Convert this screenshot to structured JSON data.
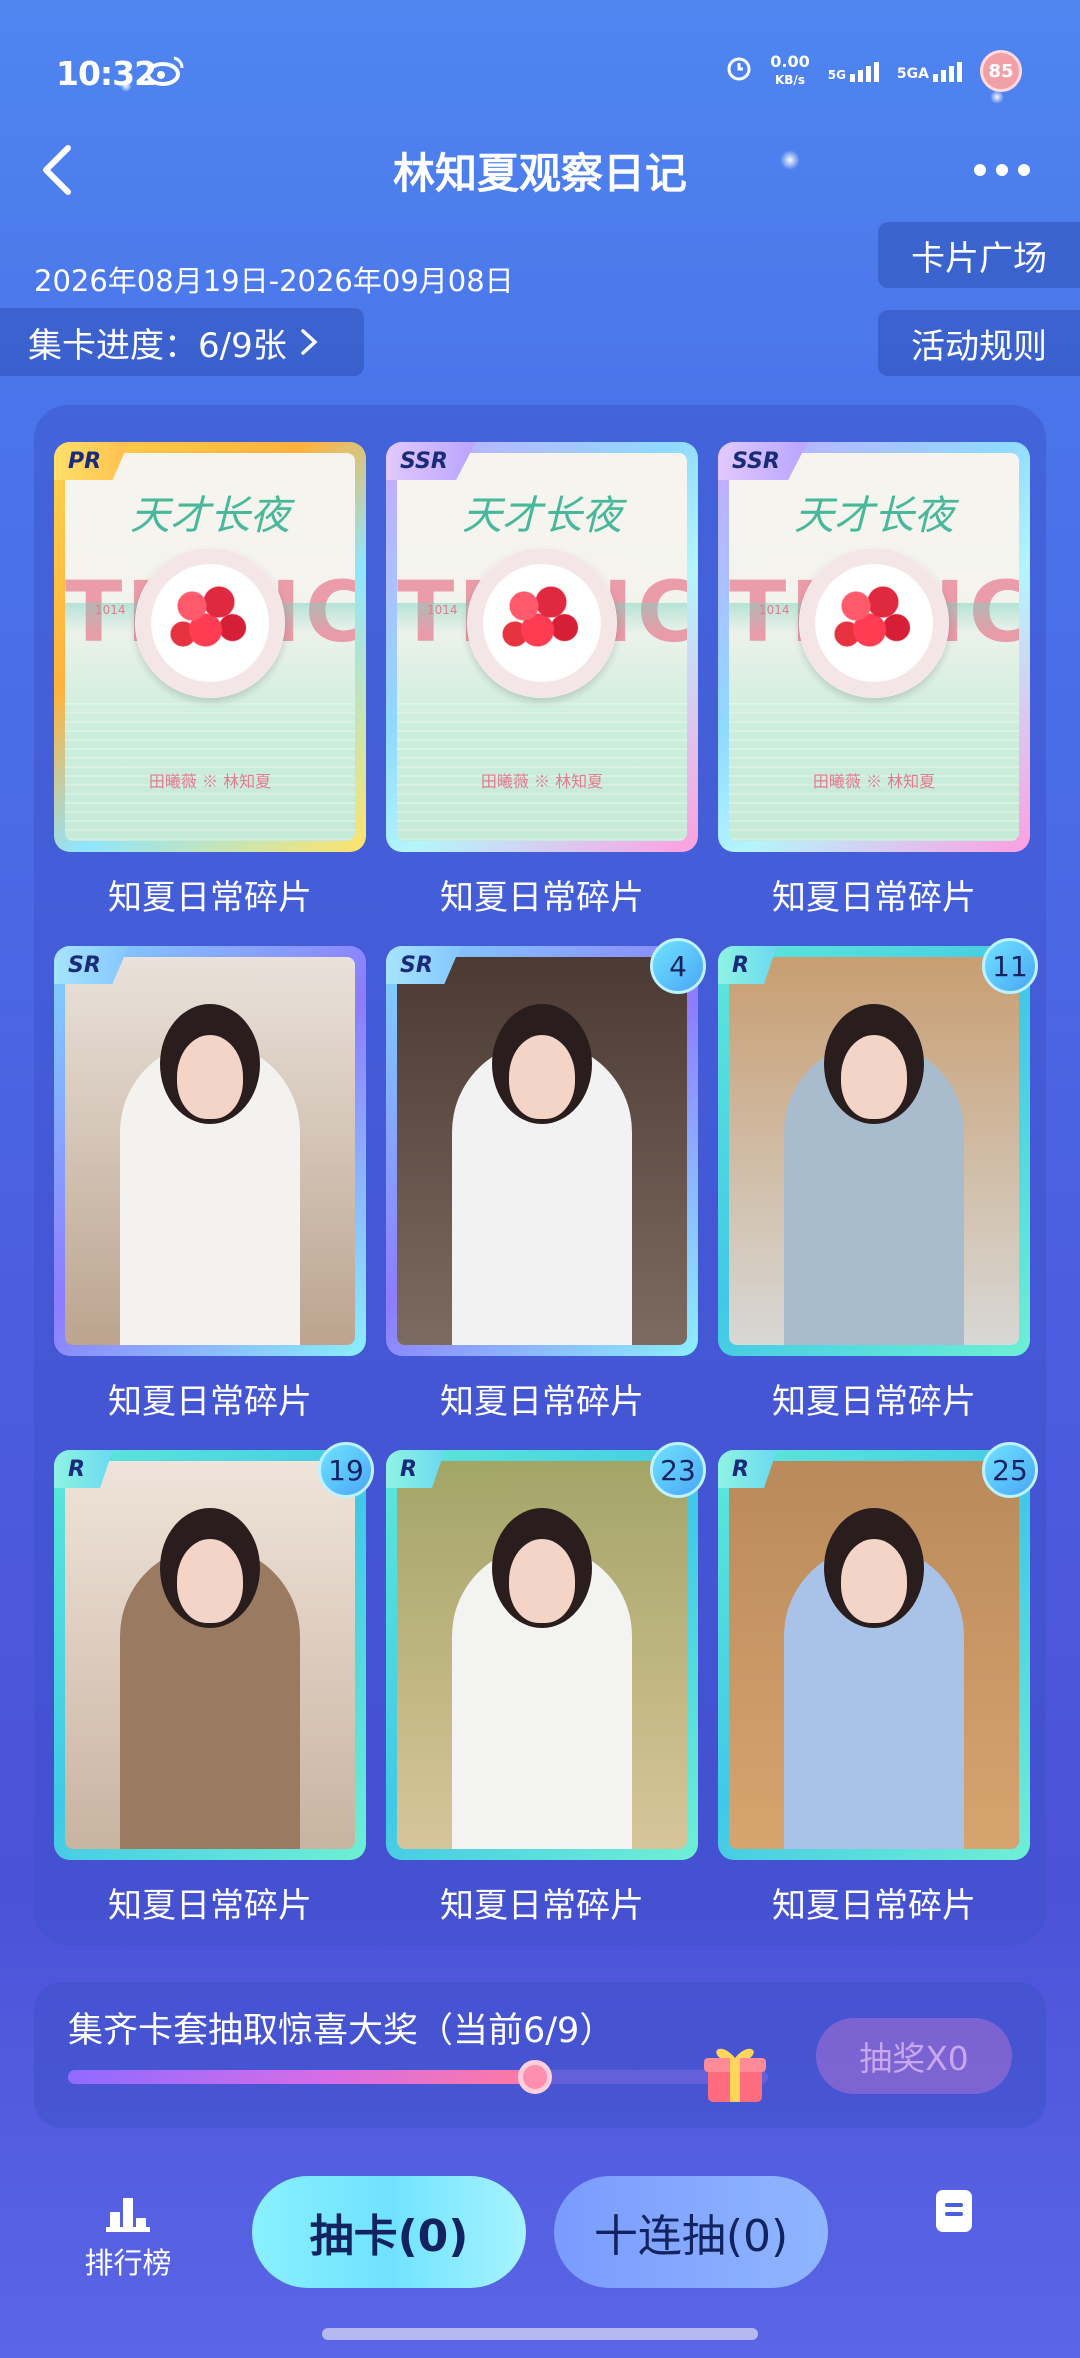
{
  "status": {
    "time": "10:32",
    "speed_value": "0.00",
    "speed_unit": "KB/s",
    "net1": "5G",
    "net2": "5GA",
    "battery": "85"
  },
  "header": {
    "title": "林知夏观察日记"
  },
  "period": "2026年08月19日-2026年09月08日",
  "collect_progress": "集卡进度：6/9张",
  "buttons": {
    "card_square": "卡片广场",
    "event_rules": "活动规则"
  },
  "cards": [
    {
      "rarity": "PR",
      "label": "知夏日常碎片",
      "count": "",
      "type": "poster"
    },
    {
      "rarity": "SSR",
      "label": "知夏日常碎片",
      "count": "",
      "type": "poster"
    },
    {
      "rarity": "SSR",
      "label": "知夏日常碎片",
      "count": "",
      "type": "poster"
    },
    {
      "rarity": "SR",
      "label": "知夏日常碎片",
      "count": "",
      "type": "photo"
    },
    {
      "rarity": "SR",
      "label": "知夏日常碎片",
      "count": "4",
      "type": "photo"
    },
    {
      "rarity": "R",
      "label": "知夏日常碎片",
      "count": "11",
      "type": "photo"
    },
    {
      "rarity": "R",
      "label": "知夏日常碎片",
      "count": "19",
      "type": "photo"
    },
    {
      "rarity": "R",
      "label": "知夏日常碎片",
      "count": "23",
      "type": "photo"
    },
    {
      "rarity": "R",
      "label": "知夏日常碎片",
      "count": "25",
      "type": "photo"
    }
  ],
  "poster": {
    "logo": "天才长夜",
    "big_text": "TIANCAIWEI",
    "side_code": "1014",
    "credit": "田曦薇 ※ 林知夏"
  },
  "lottery": {
    "text": "集齐卡套抽取惊喜大奖（当前6/9）",
    "progress": 0.667,
    "button": "抽奖X0"
  },
  "footer": {
    "rank": "排行榜",
    "draw_one": "抽卡(0)",
    "draw_ten": "十连抽(0)"
  },
  "colors": {
    "accent_cyan": "#6fe2ff",
    "rarity_pr": "#ffd34d",
    "rarity_ssr": "#c8a8ff",
    "rarity_sr": "#7fd5ff",
    "rarity_r": "#5ee8d8"
  }
}
